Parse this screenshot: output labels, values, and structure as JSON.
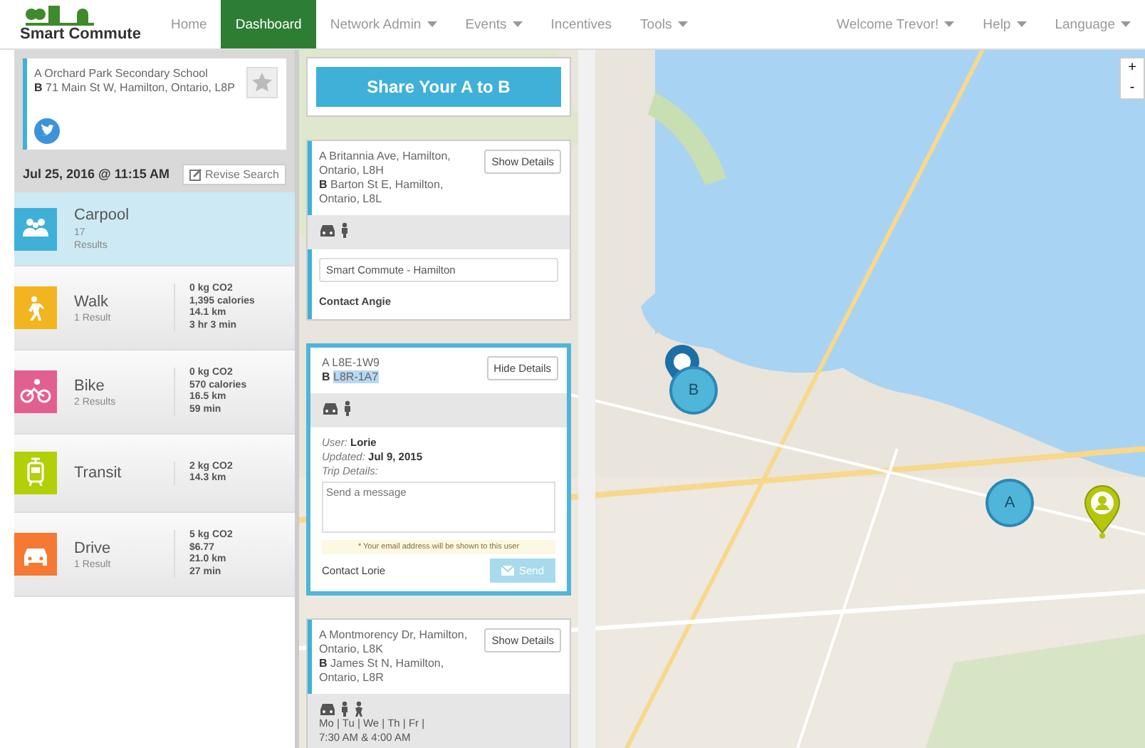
{
  "navbar": {
    "logo": "Smart Commute",
    "items": [
      {
        "label": "Home",
        "selected": false,
        "dropdown": false
      },
      {
        "label": "Dashboard",
        "selected": true,
        "dropdown": false
      },
      {
        "label": "Network Admin",
        "selected": false,
        "dropdown": true
      },
      {
        "label": "Events",
        "selected": false,
        "dropdown": true
      },
      {
        "label": "Incentives",
        "selected": false,
        "dropdown": false
      },
      {
        "label": "Tools",
        "selected": false,
        "dropdown": true
      }
    ],
    "right_items": [
      {
        "label": "Welcome Trevor!",
        "dropdown": true
      },
      {
        "label": "Help",
        "dropdown": true
      },
      {
        "label": "Language",
        "dropdown": true
      }
    ]
  },
  "trip": {
    "a_label": "A",
    "a": "Orchard Park Secondary School",
    "b_label": "B",
    "b": "71 Main St W, Hamilton, Ontario, L8P",
    "favorite": false
  },
  "search": {
    "datetime": "Jul 25, 2016 @ 11:15 AM",
    "revise": "Revise Search"
  },
  "modes": [
    {
      "kind": "carpool",
      "name": "Carpool",
      "results": "17 Results",
      "color": "#3fb0d8",
      "selected": true
    },
    {
      "kind": "walk",
      "name": "Walk",
      "results": "1 Result",
      "color": "#f2b51f",
      "selected": false,
      "stats": [
        "0 kg CO2",
        "1,395 calories",
        "14.1 km",
        "3 hr 3 min"
      ]
    },
    {
      "kind": "bike",
      "name": "Bike",
      "results": "2 Results",
      "color": "#e2608f",
      "selected": false,
      "stats": [
        "0 kg CO2",
        "570 calories",
        "16.5 km",
        "59 min"
      ]
    },
    {
      "kind": "transit",
      "name": "Transit",
      "color": "#b3cf06",
      "selected": false,
      "stats": [
        "2 kg CO2",
        "14.3 km"
      ]
    },
    {
      "kind": "drive",
      "name": "Drive",
      "results": "1 Result",
      "color": "#f57932",
      "selected": false,
      "stats": [
        "5 kg CO2",
        "$6.77",
        "21.0 km",
        "27 min"
      ]
    }
  ],
  "share_button": "Share Your A to B",
  "cards": [
    {
      "a_label": "A",
      "a": "Britannia Ave, Hamilton, Ontario, L8H",
      "b_label": "B",
      "b": "Barton St E, Hamilton, Ontario, L8L",
      "b_highlighted": false,
      "toggle": "Show Details",
      "expanded": false,
      "icons": [
        {
          "kind": "car"
        },
        {
          "kind": "walker"
        }
      ],
      "group": "Smart Commute - Hamilton",
      "contact": "Contact Angie"
    },
    {
      "a_label": "A",
      "a": "L8E-1W9",
      "b_label": "B",
      "b": "L8R-1A7",
      "b_highlighted": true,
      "toggle": "Hide Details",
      "expanded": true,
      "icons": [
        {
          "kind": "car"
        },
        {
          "kind": "walker"
        }
      ],
      "user_label": "User:",
      "user": "Lorie",
      "updated_label": "Updated:",
      "updated": "Jul 9, 2015",
      "trip_details_label": "Trip Details:",
      "message_placeholder": "Send a message",
      "notice": "* Your email address will be shown to this user",
      "contact": "Contact Lorie",
      "send": "Send",
      "send_disabled": true
    },
    {
      "a_label": "A",
      "a": "Montmorency Dr, Hamilton, Ontario, L8K",
      "b_label": "B",
      "b": "James St N, Hamilton, Ontario, L8R",
      "b_highlighted": false,
      "toggle": "Show Details",
      "expanded": false,
      "icons": [
        {
          "kind": "car"
        },
        {
          "kind": "walker"
        },
        {
          "kind": "runner"
        }
      ],
      "days": "Mo | Tu | We | Th | Fr |",
      "times": "7:30 AM & 4:00 AM"
    }
  ],
  "map": {
    "markers": [
      {
        "label": "B"
      },
      {
        "label": "A"
      }
    ],
    "zoom": [
      "+",
      "-"
    ]
  }
}
